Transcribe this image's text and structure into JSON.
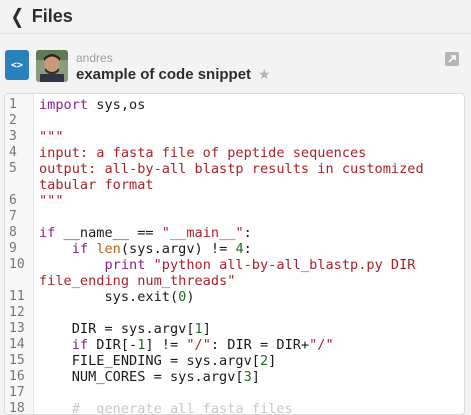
{
  "header": {
    "back_label": "Files"
  },
  "file": {
    "author": "andres",
    "title": "example of code snippet",
    "type_icon_label": "<>"
  },
  "code_lines": [
    {
      "n": "1",
      "parts": [
        [
          "k",
          "import"
        ],
        [
          "t",
          " sys,os"
        ]
      ]
    },
    {
      "n": "2",
      "parts": []
    },
    {
      "n": "3",
      "parts": [
        [
          "s",
          "\"\"\""
        ]
      ]
    },
    {
      "n": "4",
      "parts": [
        [
          "s",
          "input: a fasta file of peptide sequences"
        ]
      ]
    },
    {
      "n": "5",
      "parts": [
        [
          "s",
          "output: all-by-all blastp results in customized"
        ]
      ]
    },
    {
      "n": "",
      "parts": [
        [
          "s",
          "tabular format"
        ]
      ]
    },
    {
      "n": "6",
      "parts": [
        [
          "s",
          "\"\"\""
        ]
      ]
    },
    {
      "n": "7",
      "parts": []
    },
    {
      "n": "8",
      "parts": [
        [
          "k",
          "if"
        ],
        [
          "t",
          " __name__ == "
        ],
        [
          "s",
          "\"__main__\""
        ],
        [
          "t",
          ":"
        ]
      ]
    },
    {
      "n": "9",
      "parts": [
        [
          "t",
          "    "
        ],
        [
          "k",
          "if"
        ],
        [
          "t",
          " "
        ],
        [
          "f",
          "len"
        ],
        [
          "t",
          "(sys.argv) != "
        ],
        [
          "n",
          "4"
        ],
        [
          "t",
          ":"
        ]
      ]
    },
    {
      "n": "10",
      "parts": [
        [
          "t",
          "        "
        ],
        [
          "k",
          "print"
        ],
        [
          "t",
          " "
        ],
        [
          "s",
          "\"python all-by-all_blastp.py DIR"
        ]
      ]
    },
    {
      "n": "",
      "parts": [
        [
          "s",
          "file_ending num_threads\""
        ]
      ]
    },
    {
      "n": "11",
      "parts": [
        [
          "t",
          "        sys.exit("
        ],
        [
          "n",
          "0"
        ],
        [
          "t",
          ")"
        ]
      ]
    },
    {
      "n": "12",
      "parts": []
    },
    {
      "n": "13",
      "parts": [
        [
          "t",
          "    DIR = sys.argv["
        ],
        [
          "n",
          "1"
        ],
        [
          "t",
          "]"
        ]
      ]
    },
    {
      "n": "14",
      "parts": [
        [
          "t",
          "    "
        ],
        [
          "k",
          "if"
        ],
        [
          "t",
          " DIR[-"
        ],
        [
          "n",
          "1"
        ],
        [
          "t",
          "] != "
        ],
        [
          "s",
          "\"/\""
        ],
        [
          "t",
          ": DIR = DIR+"
        ],
        [
          "s",
          "\"/\""
        ]
      ]
    },
    {
      "n": "15",
      "parts": [
        [
          "t",
          "    FILE_ENDING = sys.argv["
        ],
        [
          "n",
          "2"
        ],
        [
          "t",
          "]"
        ]
      ]
    },
    {
      "n": "16",
      "parts": [
        [
          "t",
          "    NUM_CORES = sys.argv["
        ],
        [
          "n",
          "3"
        ],
        [
          "t",
          "]"
        ]
      ]
    },
    {
      "n": "17",
      "parts": []
    },
    {
      "n": "18",
      "parts": [
        [
          "x",
          "    #  generate all fasta files"
        ]
      ]
    }
  ],
  "colors": {
    "keyword": "#8f1f8a",
    "string": "#a8222a",
    "number": "#1d6e1d",
    "builtin": "#b0641a",
    "icon_blue": "#2a80b9"
  },
  "icons": [
    "chevron-left-icon",
    "code-snippet-icon",
    "star-icon",
    "expand-icon"
  ]
}
